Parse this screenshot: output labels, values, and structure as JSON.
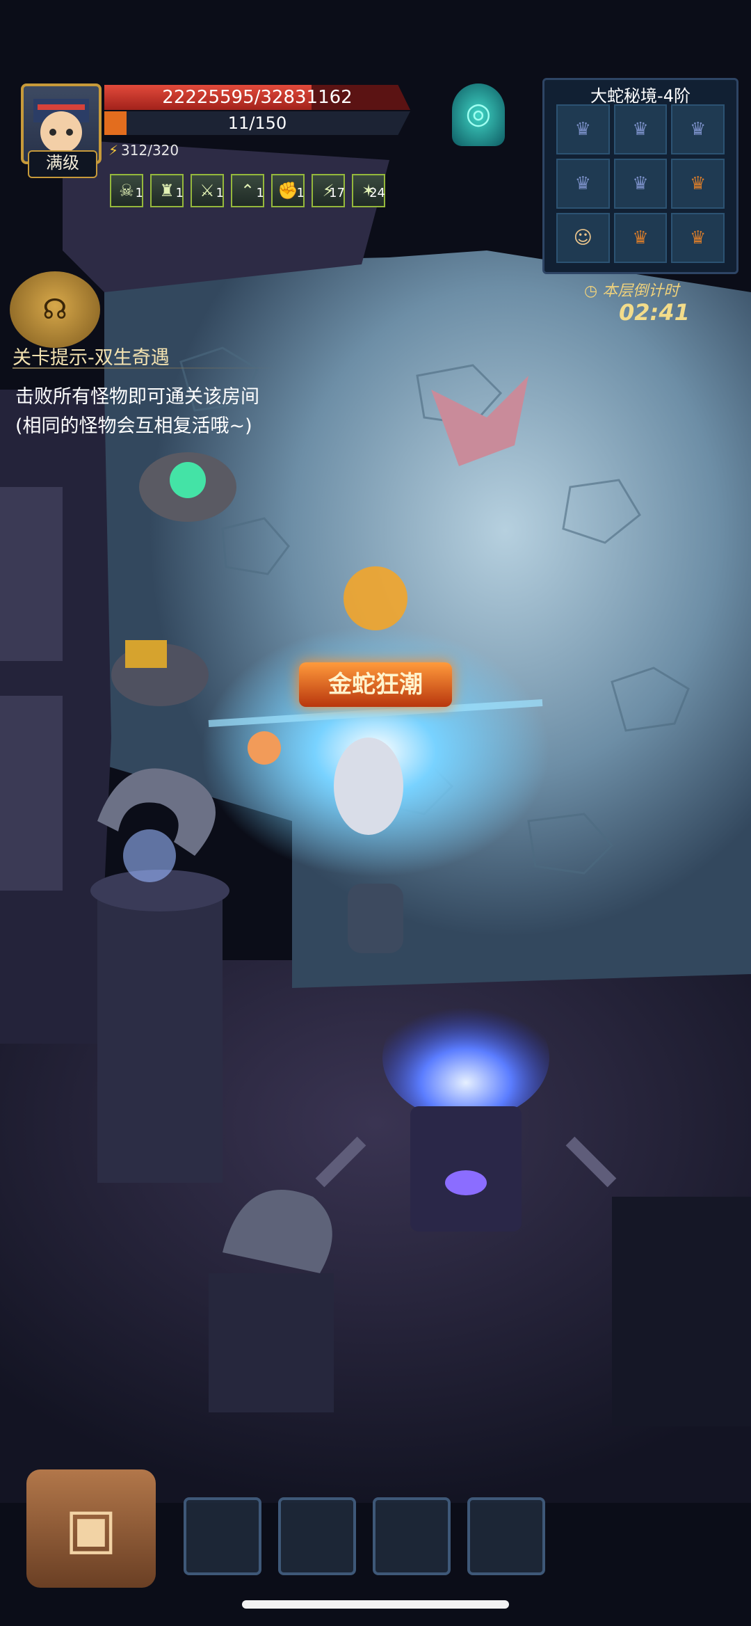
{
  "player": {
    "level_label": "满级",
    "hp_text": "22225595/32831162",
    "hp_fraction": 0.677,
    "xp_text": "11/150",
    "xp_fraction": 0.073,
    "energy_text": "312/320"
  },
  "buffs": [
    {
      "icon": "ghost-icon",
      "count": "1"
    },
    {
      "icon": "golden-helmet-icon",
      "count": "1"
    },
    {
      "icon": "crossed-swords-icon",
      "count": "1"
    },
    {
      "icon": "rank-chevron-icon",
      "count": "1"
    },
    {
      "icon": "strength-arm-icon",
      "count": "1"
    },
    {
      "icon": "sword-strike-icon",
      "count": "17"
    },
    {
      "icon": "claw-icon",
      "count": "24"
    }
  ],
  "minimap": {
    "title": "大蛇秘境-4阶",
    "countdown_label": "本层倒计时",
    "countdown_value": "02:41"
  },
  "hint": {
    "title": "关卡提示-双生奇遇",
    "line1": "击败所有怪物即可通关该房间",
    "line2": "(相同的怪物会互相复活哦~)"
  },
  "skill_banner": "金蛇狂潮",
  "colors": {
    "hp": "#e24a3b",
    "xp": "#e36d1e",
    "gold": "#c79a3a",
    "floor": "#5f7f95"
  }
}
